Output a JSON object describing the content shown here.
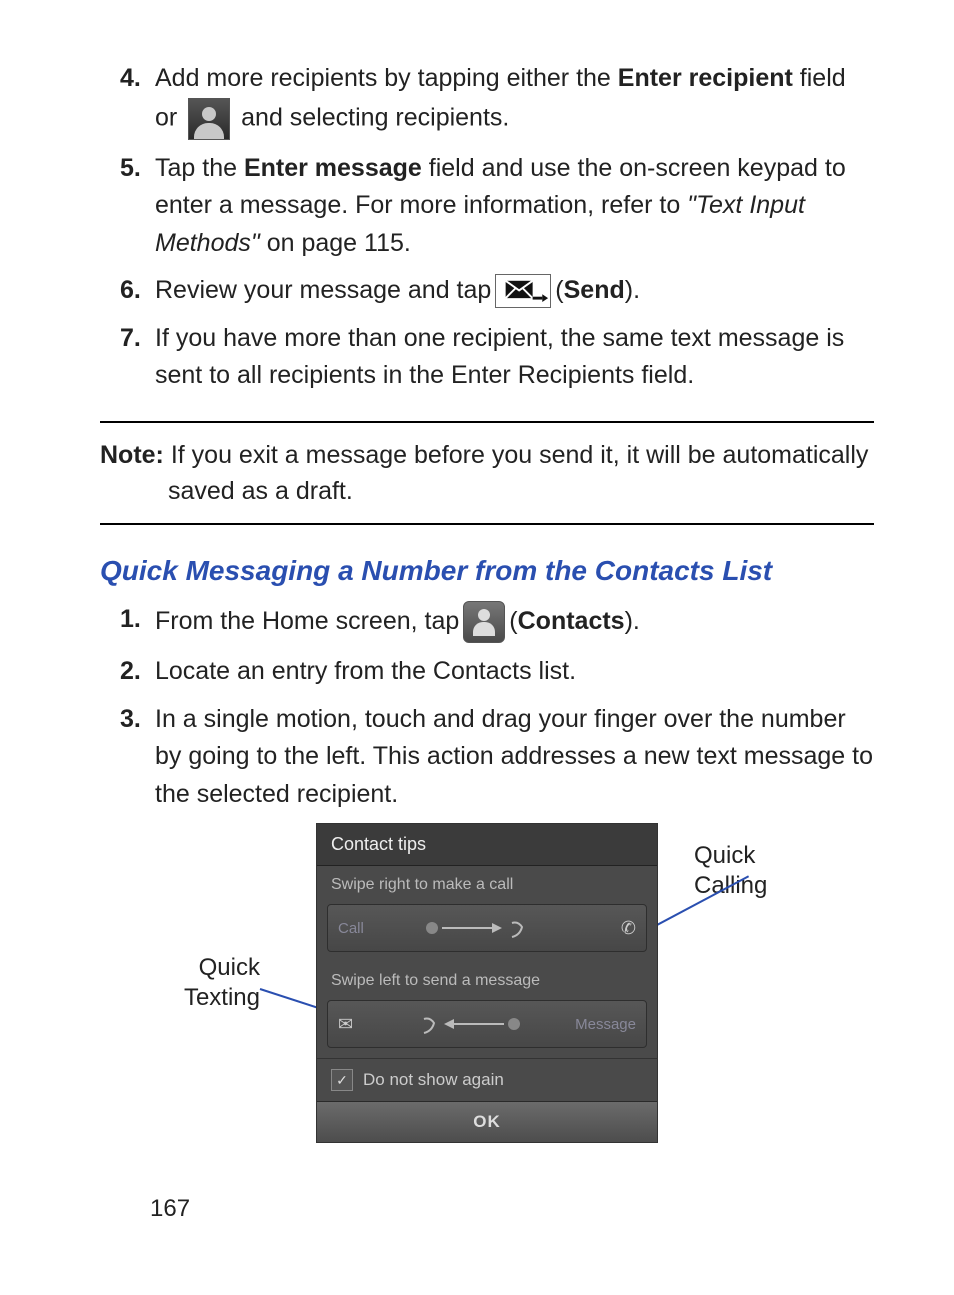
{
  "steps_a": [
    {
      "num": "4.",
      "pre": "Add more recipients by tapping either the ",
      "bold1": "Enter recipient",
      "mid": " field or ",
      "after_icon": " and selecting recipients."
    },
    {
      "num": "5.",
      "pre": "Tap the ",
      "bold1": "Enter message",
      "mid": " field and use the on-screen keypad to enter a message. For more information, refer to ",
      "ital": "\"Text Input Methods\"",
      "tail": "  on page 115."
    },
    {
      "num": "6.",
      "pre": "Review your message and tap ",
      "after_icon_open": " (",
      "bold1": "Send",
      "after_icon_close": ")."
    },
    {
      "num": "7.",
      "pre": "If you have more than one recipient, the same text message is sent to all recipients in the Enter Recipients field."
    }
  ],
  "note": {
    "label": "Note:",
    "text": " If you exit a message before you send it, it will be automatically saved as a draft."
  },
  "heading": "Quick Messaging a Number from the Contacts List",
  "steps_b": [
    {
      "num": "1.",
      "pre": "From the Home screen, tap ",
      "after_icon_open": " (",
      "bold1": "Contacts",
      "after_icon_close": ")."
    },
    {
      "num": "2.",
      "pre": "Locate an entry from the Contacts list."
    },
    {
      "num": "3.",
      "pre": "In a single motion, touch and drag your finger over the number by going to the left. This action addresses a new text message to the selected recipient."
    }
  ],
  "phone": {
    "title": "Contact tips",
    "swipe_call_label": "Swipe right to make a call",
    "call_word": "Call",
    "swipe_msg_label": "Swipe left to send a message",
    "msg_word": "Message",
    "checkbox": "Do not show again",
    "ok": "OK"
  },
  "callouts": {
    "left": "Quick Texting",
    "right": "Quick Calling"
  },
  "page_number": "167"
}
